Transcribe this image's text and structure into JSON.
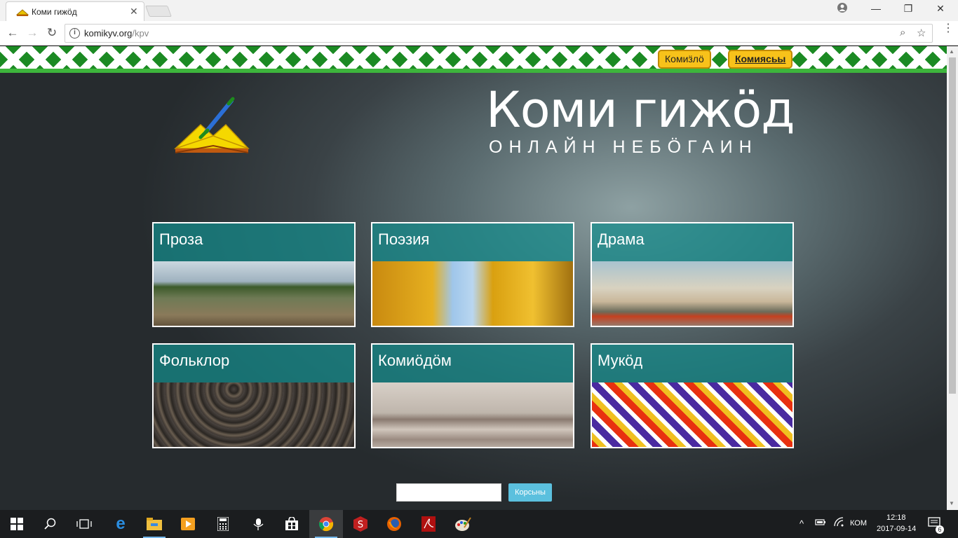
{
  "browser": {
    "tab_title": "Коми гижӧд",
    "url_host": "komikyv.org",
    "url_path": "/kpv"
  },
  "header": {
    "lang_buttons": [
      {
        "label": "Комиӟлӧ",
        "active": false
      },
      {
        "label": "Комиясьы",
        "active": true
      }
    ]
  },
  "site": {
    "title": "Коми гижӧд",
    "subtitle": "ОНЛАЙН НЕБӦГАИН"
  },
  "categories": [
    {
      "label": "Проза"
    },
    {
      "label": "Поэзия"
    },
    {
      "label": "Драма"
    },
    {
      "label": "Фольклор"
    },
    {
      "label": "Комиӧдӧм"
    },
    {
      "label": "Мукӧд"
    }
  ],
  "search": {
    "placeholder": "",
    "button_label": "Корсьны"
  },
  "taskbar": {
    "language": "КОМ",
    "time": "12:18",
    "date": "2017-09-14",
    "notification_count": "6"
  }
}
